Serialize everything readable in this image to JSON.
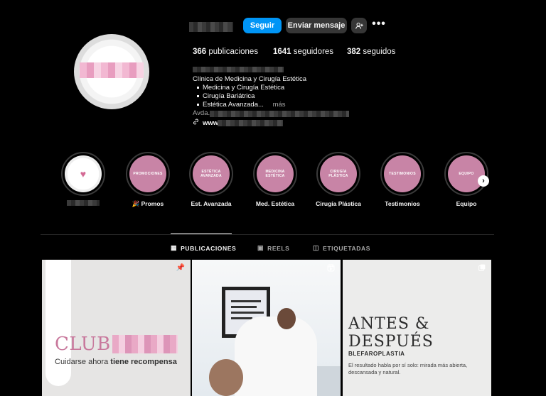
{
  "header": {
    "follow_label": "Seguir",
    "message_label": "Enviar mensaje",
    "add_user_icon": "add-user-icon",
    "more_icon": "more-icon",
    "stats": {
      "posts_count": "366",
      "posts_label": "publicaciones",
      "followers_count": "1641",
      "followers_label": "seguidores",
      "following_count": "382",
      "following_label": "seguidos"
    }
  },
  "bio": {
    "category": "Clínica de Medicina y Cirugía Estética",
    "bullets": [
      "Medicina y Cirugía Estética",
      "Cirugía Bariátrica",
      "Estética Avanzada..."
    ],
    "more_label": "más",
    "address_prefix": "Avda.",
    "link_prefix": "www."
  },
  "highlights": [
    {
      "label": "",
      "cover": ""
    },
    {
      "label": "Promos",
      "cover": "PROMOCIONES"
    },
    {
      "label": "Est. Avanzada",
      "cover": "ESTÉTICA AVANZADA"
    },
    {
      "label": "Med. Estética",
      "cover": "MEDICINA ESTÉTICA"
    },
    {
      "label": "Cirugía Plástica",
      "cover": "CIRUGÍA PLÁSTICA"
    },
    {
      "label": "Testimonios",
      "cover": "TESTIMONIOS"
    },
    {
      "label": "Equipo",
      "cover": "EQUIPO"
    }
  ],
  "tabs": [
    {
      "label": "PUBLICACIONES",
      "icon": "grid-icon"
    },
    {
      "label": "REELS",
      "icon": "reels-icon"
    },
    {
      "label": "ETIQUETADAS",
      "icon": "tagged-icon"
    }
  ],
  "posts": [
    {
      "club": "CLUB",
      "tagline_start": "Cuidarse ahora",
      "tagline_bold": "tiene recompensa",
      "badge": "pin-icon"
    },
    {
      "badge": "reel-icon"
    },
    {
      "title_line1": "ANTES &",
      "title_line2": "DESPUÉS",
      "subtitle": "BLEFAROPLASTIA",
      "description": "El resultado habla por sí solo: mirada más abierta, descansada y natural.",
      "badge": "carousel-icon"
    }
  ],
  "colors": {
    "background": "#000000",
    "accent_blue": "#0095f6",
    "highlight_pink": "#c884a6",
    "button_gray": "#363636"
  }
}
